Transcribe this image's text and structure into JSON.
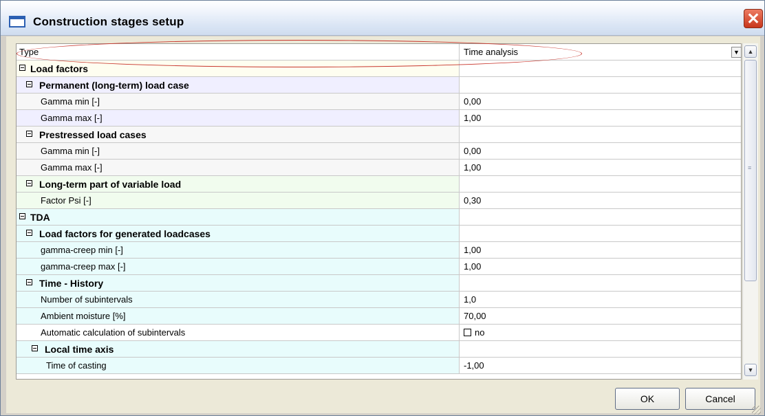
{
  "window": {
    "title": "Construction stages setup",
    "close_symbol": "✕"
  },
  "grid": {
    "type_row": {
      "label": "Type",
      "value": "Time analysis"
    },
    "rows": [
      {
        "label": "Load factors",
        "value": "",
        "group": true
      },
      {
        "label": "Permanent (long-term) load case",
        "value": "",
        "group": true
      },
      {
        "label": "Gamma min [-]",
        "value": "0,00"
      },
      {
        "label": "Gamma max [-]",
        "value": "1,00"
      },
      {
        "label": "Prestressed load cases",
        "value": "",
        "group": true
      },
      {
        "label": "Gamma min [-]",
        "value": "0,00"
      },
      {
        "label": "Gamma max [-]",
        "value": "1,00"
      },
      {
        "label": "Long-term part of variable load",
        "value": "",
        "group": true
      },
      {
        "label": "Factor Psi [-]",
        "value": "0,30"
      },
      {
        "label": "TDA",
        "value": "",
        "group": true
      },
      {
        "label": "Load factors for generated loadcases",
        "value": "",
        "group": true
      },
      {
        "label": "gamma-creep min [-]",
        "value": "1,00"
      },
      {
        "label": "gamma-creep max [-]",
        "value": "1,00"
      },
      {
        "label": "Time - History",
        "value": "",
        "group": true
      },
      {
        "label": "Number of subintervals",
        "value": "1,0"
      },
      {
        "label": "Ambient moisture [%]",
        "value": "70,00"
      },
      {
        "label": "Automatic calculation of subintervals",
        "value": "no",
        "checkbox": true
      },
      {
        "label": "Local time axis",
        "value": "",
        "group": true
      },
      {
        "label": "Time of casting",
        "value": "-1,00"
      }
    ]
  },
  "scrollbar": {
    "up_symbol": "▲",
    "down_symbol": "▼",
    "grip_symbol": "≡"
  },
  "combo": {
    "arrow_symbol": "▼"
  },
  "buttons": {
    "ok_label": "OK",
    "cancel_label": "Cancel"
  }
}
